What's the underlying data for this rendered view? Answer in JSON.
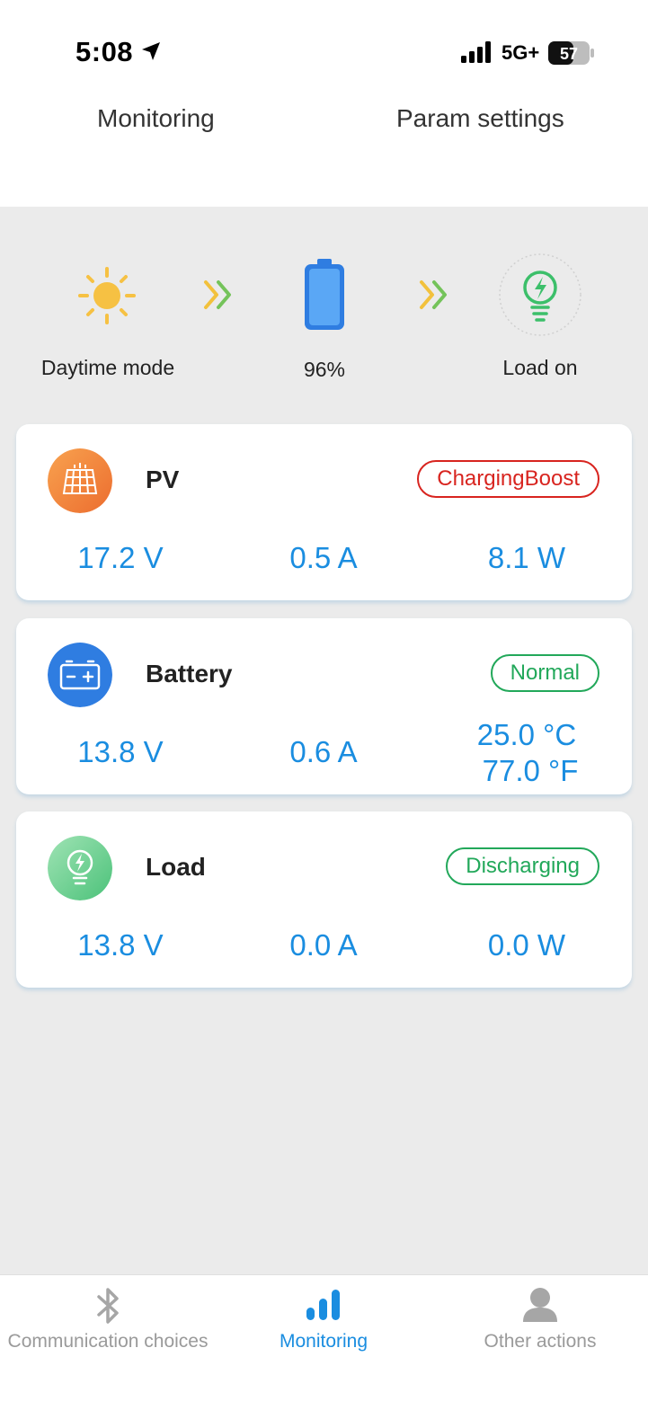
{
  "status_bar": {
    "time": "5:08",
    "network": "5G+",
    "battery": "57"
  },
  "tabs": {
    "monitoring": "Monitoring",
    "param_settings": "Param settings"
  },
  "flow": {
    "mode_label": "Daytime mode",
    "battery_label": "96%",
    "load_label": "Load on"
  },
  "cards": {
    "pv": {
      "title": "PV",
      "status": "ChargingBoost",
      "voltage": "17.2 V",
      "current": "0.5 A",
      "power": "8.1 W"
    },
    "battery": {
      "title": "Battery",
      "status": "Normal",
      "voltage": "13.8 V",
      "current": "0.6 A",
      "temp_c": "25.0 °C",
      "temp_f": "77.0 °F"
    },
    "load": {
      "title": "Load",
      "status": "Discharging",
      "voltage": "13.8 V",
      "current": "0.0 A",
      "power": "0.0 W"
    }
  },
  "bottom_nav": {
    "communication": "Communication choices",
    "monitoring": "Monitoring",
    "other": "Other actions"
  },
  "colors": {
    "accent": "#1a8de0",
    "red": "#d8241f",
    "green": "#22a85a"
  }
}
